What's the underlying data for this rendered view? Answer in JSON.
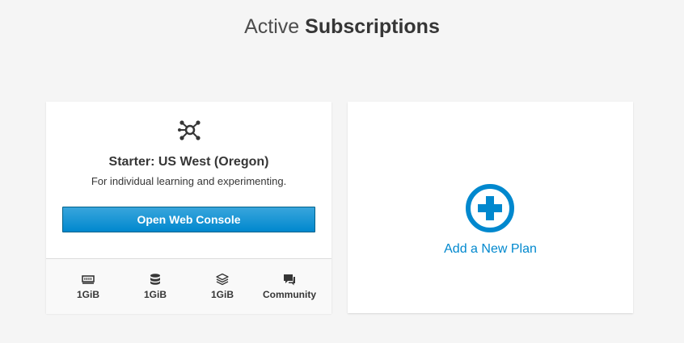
{
  "heading": {
    "light": "Active",
    "bold": "Subscriptions"
  },
  "plan": {
    "icon": "network-nodes-icon",
    "title": "Starter: US West (Oregon)",
    "description": "For individual learning and experimenting.",
    "button_label": "Open Web Console",
    "stats": [
      {
        "icon": "memory-icon",
        "value": "1GiB"
      },
      {
        "icon": "database-icon",
        "value": "1GiB"
      },
      {
        "icon": "layers-icon",
        "value": "1GiB"
      },
      {
        "icon": "chat-icon",
        "value": "Community"
      }
    ]
  },
  "add_plan": {
    "icon": "plus-circle-icon",
    "label": "Add a New Plan"
  },
  "colors": {
    "background": "#f5f5f5",
    "accent": "#0088ce",
    "text": "#363636"
  }
}
